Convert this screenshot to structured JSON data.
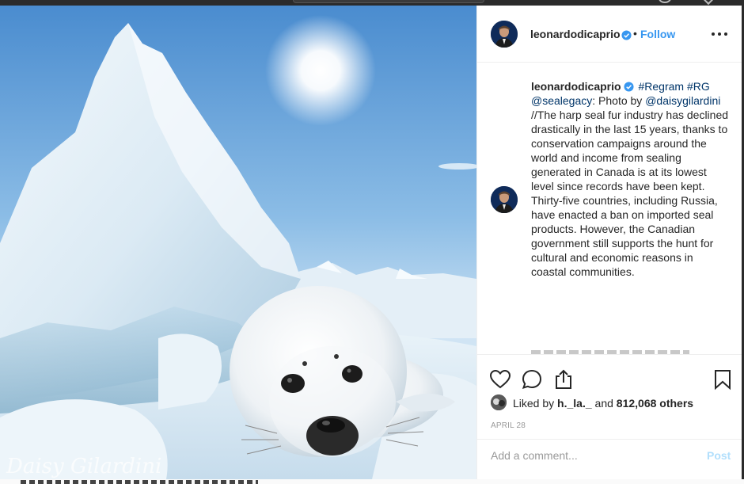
{
  "post": {
    "username": "leonardodicaprio",
    "follow_label": "Follow",
    "dot": "•",
    "caption": {
      "tags_line": "#Regram #RG",
      "mention1": "@sealegacy",
      "photo_by_text": ": Photo by ",
      "mention2": "@daisygilardini",
      "body": "//The harp seal fur industry has declined drastically in the last 15 years, thanks to conservation campaigns around the world and income from sealing generated in Canada is at its lowest level since records have been kept. Thirty-five countries, including Russia, have enacted a ban on imported seal products. However, the Canadian government still supports the hunt for cultural and economic reasons in coastal communities."
    },
    "likes": {
      "liked_by_prefix": "Liked by ",
      "first_liker": "h._la._",
      "and_text": " and ",
      "others_count_text": "812,068 others"
    },
    "date": "APRIL 28",
    "comment": {
      "placeholder": "Add a comment...",
      "post_label": "Post"
    },
    "photo_watermark": "Daisy Gilardini"
  },
  "colors": {
    "link_blue": "#3897f0",
    "tag_blue": "#003569",
    "muted": "#999999",
    "post_disabled": "#b2dffc"
  },
  "icons": [
    "verified-badge-icon",
    "more-options-icon",
    "heart-icon",
    "comment-icon",
    "share-icon",
    "bookmark-icon"
  ]
}
